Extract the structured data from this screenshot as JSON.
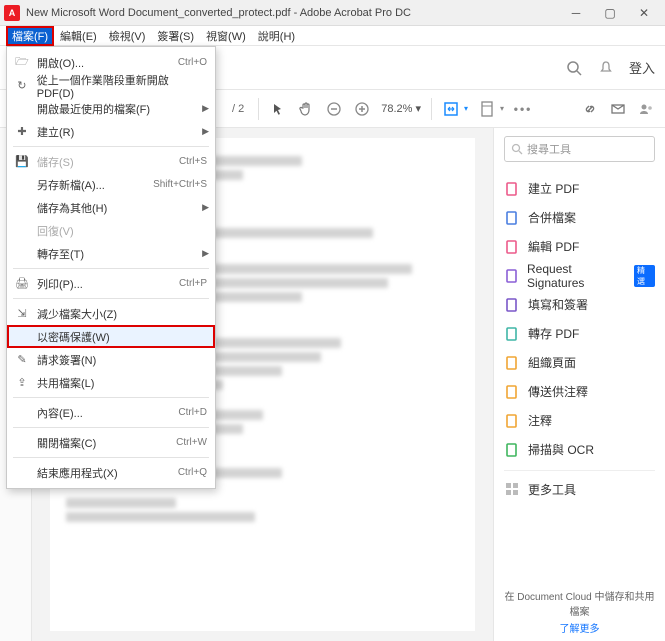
{
  "window": {
    "title": "New Microsoft Word Document_converted_protect.pdf - Adobe Acrobat Pro DC",
    "app_icon_letter": "A"
  },
  "menubar": {
    "items": [
      "檔案(F)",
      "編輯(E)",
      "檢視(V)",
      "簽署(S)",
      "視窗(W)",
      "說明(H)"
    ]
  },
  "toolbar": {
    "login": "登入",
    "page_indicator": "/ 2",
    "zoom": "78.2%"
  },
  "file_menu": {
    "open": "開啟(O)...",
    "open_sc": "Ctrl+O",
    "reopen": "從上一個作業階段重新開啟 PDF(D)",
    "recent": "開啟最近使用的檔案(F)",
    "create": "建立(R)",
    "save": "儲存(S)",
    "save_sc": "Ctrl+S",
    "saveas": "另存新檔(A)...",
    "saveas_sc": "Shift+Ctrl+S",
    "saveother": "儲存為其他(H)",
    "revert": "回復(V)",
    "exportto": "轉存至(T)",
    "print": "列印(P)...",
    "print_sc": "Ctrl+P",
    "reduce": "減少檔案大小(Z)",
    "password": "以密碼保護(W)",
    "reqsig": "請求簽署(N)",
    "share": "共用檔案(L)",
    "properties": "內容(E)...",
    "properties_sc": "Ctrl+D",
    "close": "關閉檔案(C)",
    "close_sc": "Ctrl+W",
    "exit": "結束應用程式(X)",
    "exit_sc": "Ctrl+Q"
  },
  "rightpanel": {
    "search_placeholder": "搜尋工具",
    "items": [
      {
        "label": "建立 PDF",
        "color": "#ec5a8a"
      },
      {
        "label": "合併檔案",
        "color": "#4a7ee0"
      },
      {
        "label": "編輯 PDF",
        "color": "#ec5a8a"
      },
      {
        "label": "Request Signatures",
        "color": "#8a5fd6",
        "badge": "精選"
      },
      {
        "label": "填寫和簽署",
        "color": "#7a56c8"
      },
      {
        "label": "轉存 PDF",
        "color": "#3fb5a6"
      },
      {
        "label": "組織頁面",
        "color": "#f0a533"
      },
      {
        "label": "傳送供注釋",
        "color": "#f0a533"
      },
      {
        "label": "注釋",
        "color": "#f0a533"
      },
      {
        "label": "掃描與 OCR",
        "color": "#3fb55e"
      }
    ],
    "more": "更多工具",
    "cloud_note": "在 Document Cloud 中儲存和共用檔案",
    "cloud_link": "了解更多"
  }
}
